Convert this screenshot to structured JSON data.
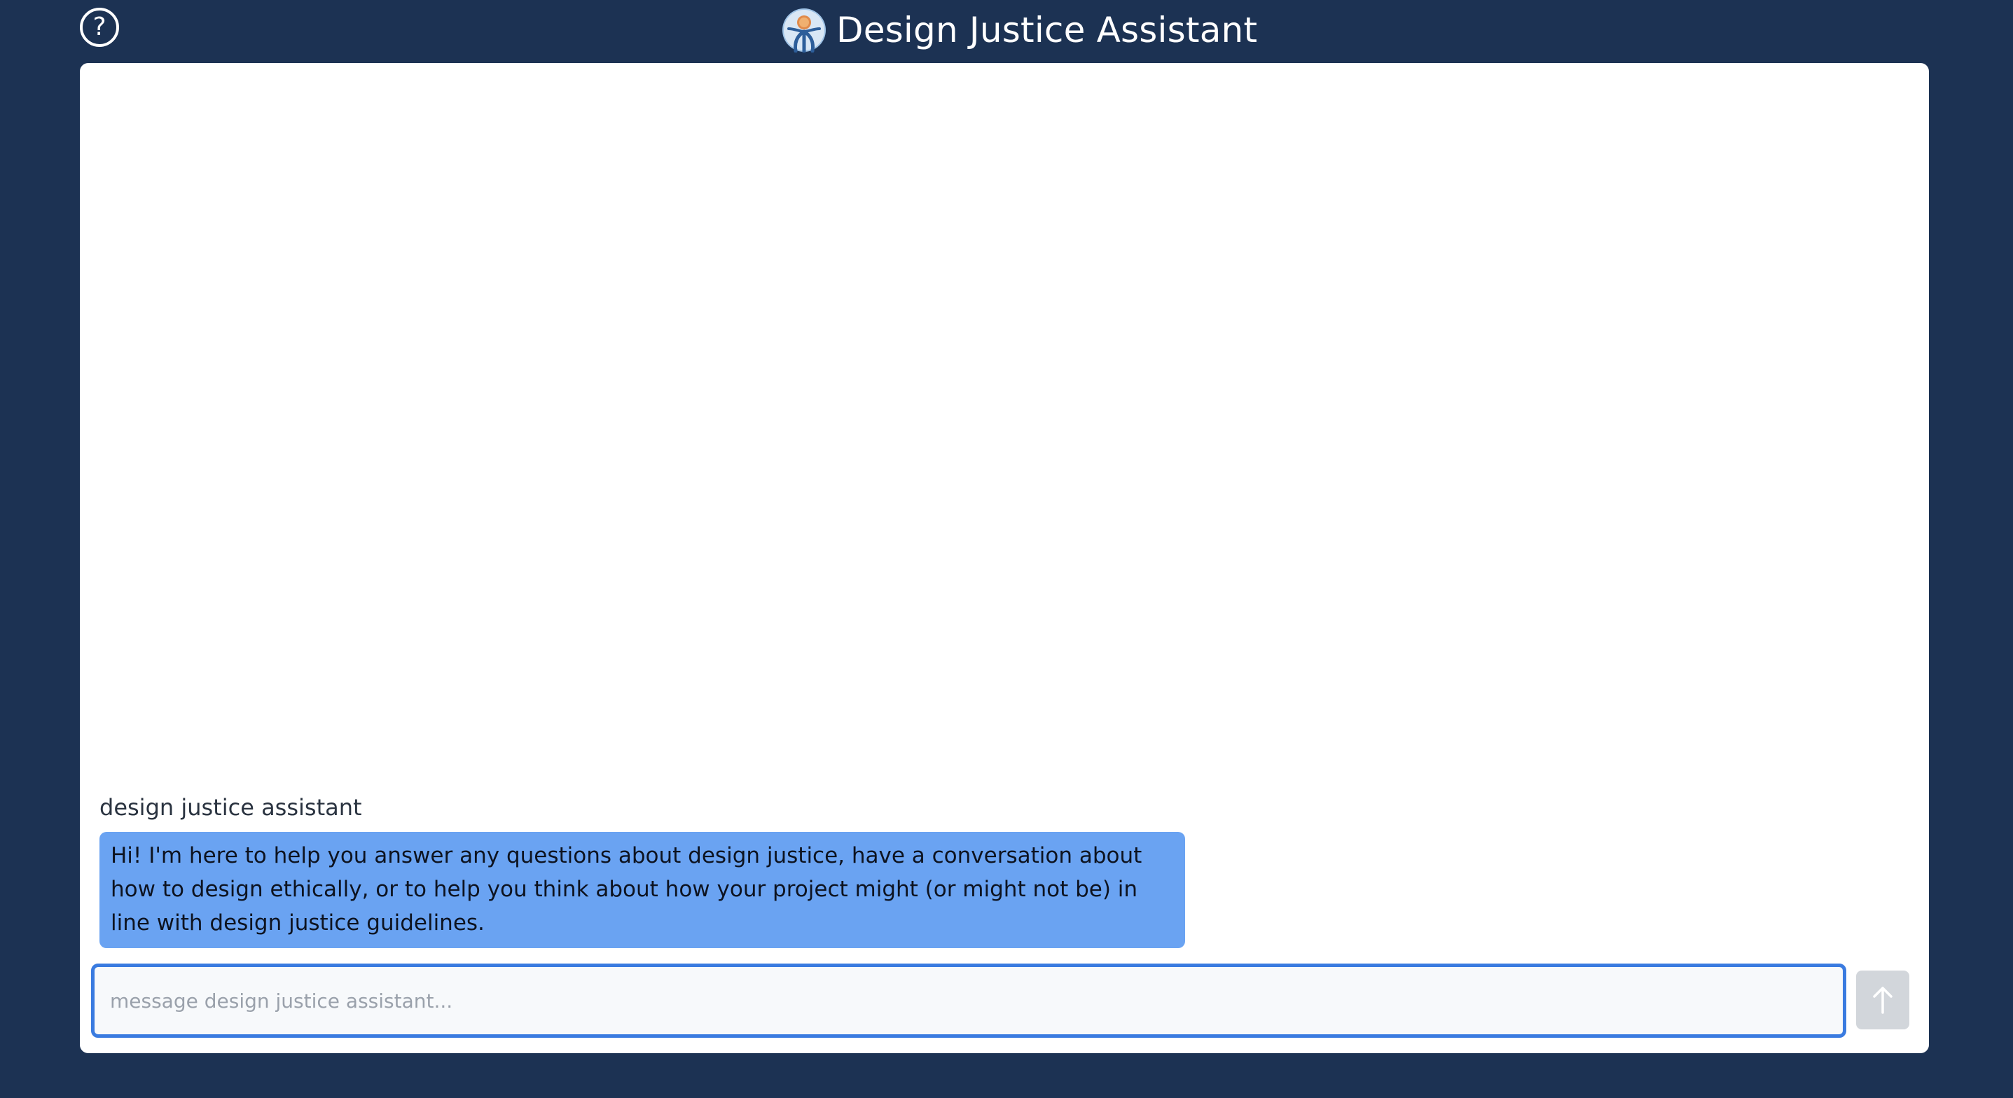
{
  "header": {
    "help_label": "?",
    "title": "Design Justice Assistant",
    "logo_icon": "tree-person-logo-icon"
  },
  "chat": {
    "messages": [
      {
        "sender": "design justice assistant",
        "text": "Hi! I'm here to help you answer any questions about design justice, have a conversation about how to design ethically, or to help you think about how your project might (or might not be) in line with design justice guidelines."
      }
    ]
  },
  "composer": {
    "placeholder": "message design justice assistant...",
    "value": "",
    "send_icon": "arrow-up-icon"
  },
  "colors": {
    "background": "#1c3253",
    "bubble": "#6aa3f2",
    "input_border": "#3a7be0",
    "send_button": "#d2d6db"
  }
}
